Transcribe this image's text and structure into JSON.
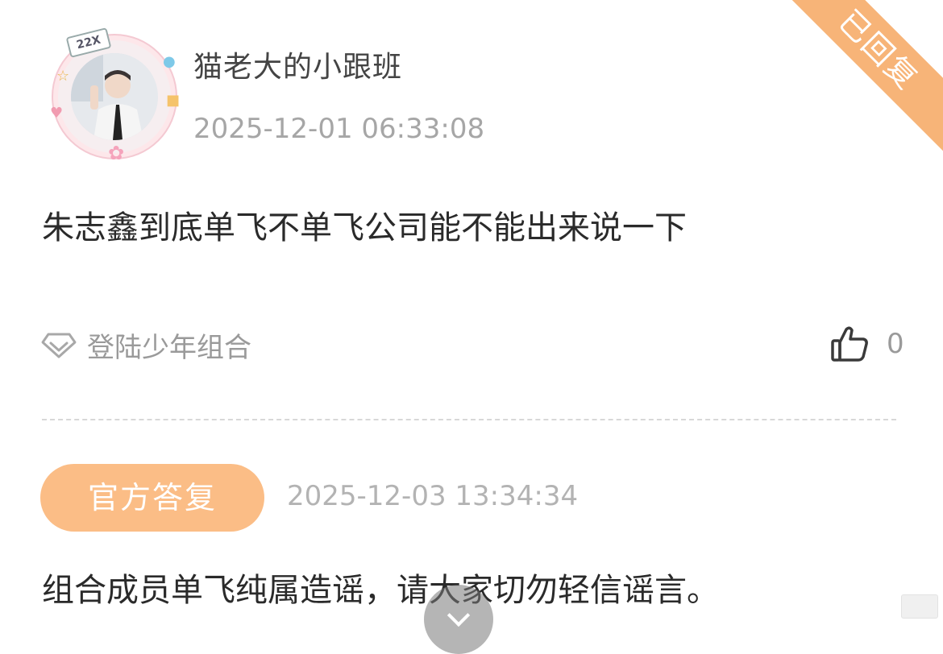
{
  "post": {
    "avatar_tag": "22X",
    "username": "猫老大的小跟班",
    "time": "2025-12-01 06:33:08",
    "replied_badge": "已回复",
    "content": "朱志鑫到底单飞不单飞公司能不能出来说一下",
    "topic": "登陆少年组合",
    "likes": "0"
  },
  "reply": {
    "badge": "官方答复",
    "time": "2025-12-03 13:34:34",
    "content": "组合成员单飞纯属造谣，请大家切勿轻信谣言。"
  },
  "colors": {
    "accent_orange": "#fbbd86",
    "ribbon_orange": "#f7b478",
    "muted_text": "#a6a6a6"
  }
}
